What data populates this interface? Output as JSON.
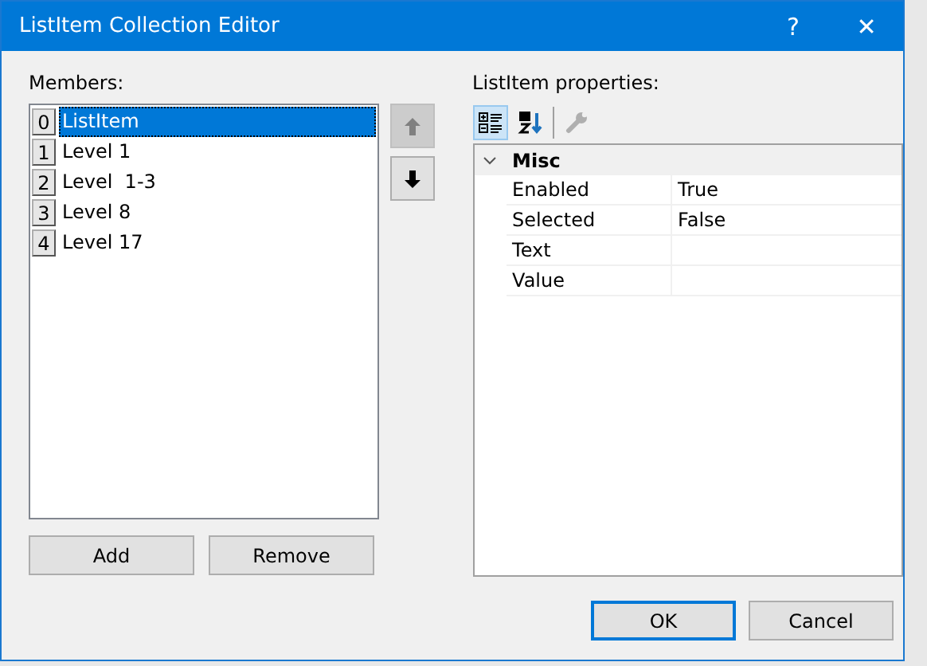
{
  "window": {
    "title": "ListItem Collection Editor",
    "help": "?",
    "close": "✕"
  },
  "members": {
    "label": "Members:",
    "items": [
      {
        "index": "0",
        "text": "ListItem",
        "selected": true
      },
      {
        "index": "1",
        "text": "Level 1",
        "selected": false
      },
      {
        "index": "2",
        "text": "Level  1-3",
        "selected": false
      },
      {
        "index": "3",
        "text": "Level 8",
        "selected": false
      },
      {
        "index": "4",
        "text": "Level 17",
        "selected": false
      }
    ],
    "move_up_disabled": true,
    "move_down_disabled": false,
    "buttons": [
      "Add",
      "Remove"
    ]
  },
  "properties": {
    "label": "ListItem properties:",
    "toolbar": [
      {
        "kind": "categorized",
        "selected": true,
        "disabled": false
      },
      {
        "kind": "alphabetical",
        "selected": false,
        "disabled": false
      },
      {
        "kind": "pages",
        "selected": false,
        "disabled": true
      }
    ],
    "category": {
      "name": "Misc",
      "expanded": true
    },
    "rows": [
      {
        "name": "Enabled",
        "value": "True"
      },
      {
        "name": "Selected",
        "value": "False"
      },
      {
        "name": "Text"
      },
      {
        "name": "Value"
      }
    ]
  },
  "buttons": [
    {
      "label": "OK",
      "default": true
    },
    {
      "label": "Cancel",
      "default": false
    }
  ]
}
